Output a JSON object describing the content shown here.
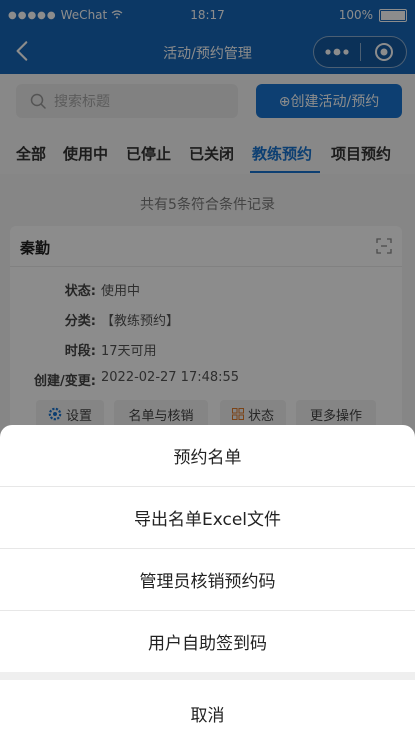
{
  "status_bar": {
    "carrier": "WeChat",
    "time": "18:17",
    "battery": "100%"
  },
  "nav": {
    "title": "活动/预约管理"
  },
  "search": {
    "placeholder": "搜索标题"
  },
  "create_button": {
    "label": "⊕创建活动/预约"
  },
  "tabs": [
    {
      "label": "全部"
    },
    {
      "label": "使用中"
    },
    {
      "label": "已停止"
    },
    {
      "label": "已关闭"
    },
    {
      "label": "教练预约"
    },
    {
      "label": "项目预约"
    }
  ],
  "record_count_text": "共有5条符合条件记录",
  "card": {
    "title": "秦勤",
    "rows": [
      {
        "label": "状态:",
        "value": "使用中"
      },
      {
        "label": "分类:",
        "value": "【教练预约】"
      },
      {
        "label": "时段:",
        "value": "17天可用"
      },
      {
        "label": "创建/变更:",
        "value": "2022-02-27 17:48:55"
      }
    ],
    "buttons": [
      {
        "label": "设置"
      },
      {
        "label": "名单与核销"
      },
      {
        "label": "状态"
      },
      {
        "label": "更多操作"
      }
    ]
  },
  "action_sheet": {
    "items": [
      {
        "label": "预约名单"
      },
      {
        "label": "导出名单Excel文件"
      },
      {
        "label": "管理员核销预约码"
      },
      {
        "label": "用户自助签到码"
      }
    ],
    "cancel": "取消"
  },
  "colors": {
    "brand": "#1767b8",
    "accent": "#1874cf"
  }
}
